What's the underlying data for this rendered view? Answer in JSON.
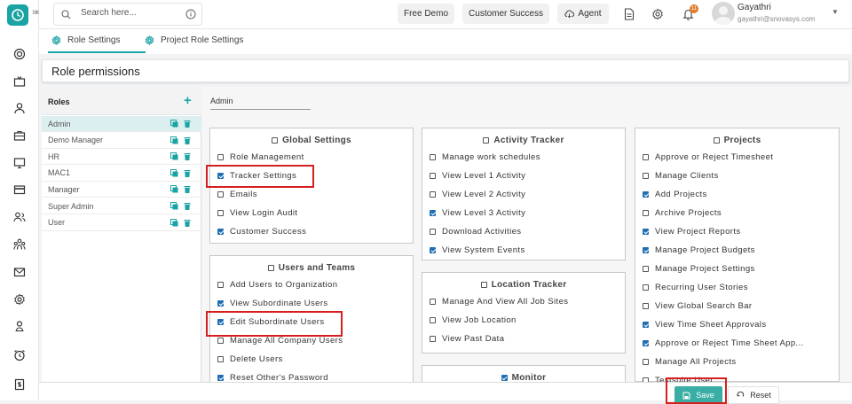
{
  "search": {
    "placeholder": "Search here..."
  },
  "topbar": {
    "free_demo": "Free Demo",
    "customer_success": "Customer Success",
    "agent": "Agent",
    "notification_count": "11",
    "user_name": "Gayathri",
    "user_email": "gayathri@snovasys.com"
  },
  "tabs": [
    {
      "label": "Role Settings"
    },
    {
      "label": "Project Role Settings"
    }
  ],
  "page_title": "Role permissions",
  "roles": {
    "header": "Roles",
    "items": [
      {
        "name": "Admin"
      },
      {
        "name": "Demo Manager"
      },
      {
        "name": "HR"
      },
      {
        "name": "MAC1"
      },
      {
        "name": "Manager"
      },
      {
        "name": "Super Admin"
      },
      {
        "name": "User"
      }
    ]
  },
  "selected_role": "Admin",
  "panels": {
    "global_settings": {
      "title": "Global Settings",
      "items": [
        {
          "label": "Role Management",
          "checked": false
        },
        {
          "label": "Tracker Settings",
          "checked": true
        },
        {
          "label": "Emails",
          "checked": false
        },
        {
          "label": "View Login Audit",
          "checked": false
        },
        {
          "label": "Customer Success",
          "checked": true
        }
      ]
    },
    "users_and_teams": {
      "title": "Users and Teams",
      "items": [
        {
          "label": "Add Users to Organization",
          "checked": false
        },
        {
          "label": "View Subordinate Users",
          "checked": true
        },
        {
          "label": "Edit Subordinate Users",
          "checked": true
        },
        {
          "label": "Manage All Company Users",
          "checked": false
        },
        {
          "label": "Delete Users",
          "checked": false
        },
        {
          "label": "Reset Other's Password",
          "checked": true
        }
      ]
    },
    "activity_tracker": {
      "title": "Activity Tracker",
      "items": [
        {
          "label": "Manage work schedules",
          "checked": false
        },
        {
          "label": "View Level 1 Activity",
          "checked": false
        },
        {
          "label": "View Level 2 Activity",
          "checked": false
        },
        {
          "label": "View Level 3 Activity",
          "checked": true
        },
        {
          "label": "Download Activities",
          "checked": false
        },
        {
          "label": "View System Events",
          "checked": true
        }
      ]
    },
    "location_tracker": {
      "title": "Location Tracker",
      "items": [
        {
          "label": "Manage And View All Job Sites",
          "checked": false
        },
        {
          "label": "View Job Location",
          "checked": false
        },
        {
          "label": "View Past Data",
          "checked": false
        }
      ]
    },
    "monitor": {
      "title": "Monitor",
      "checked": true
    },
    "projects": {
      "title": "Projects",
      "items": [
        {
          "label": "Approve or Reject Timesheet",
          "checked": false
        },
        {
          "label": "Manage Clients",
          "checked": false
        },
        {
          "label": "Add Projects",
          "checked": true
        },
        {
          "label": "Archive Projects",
          "checked": false
        },
        {
          "label": "View Project Reports",
          "checked": true
        },
        {
          "label": "Manage Project Budgets",
          "checked": true
        },
        {
          "label": "Manage Project Settings",
          "checked": false
        },
        {
          "label": "Recurring User Stories",
          "checked": false
        },
        {
          "label": "View Global Search Bar",
          "checked": false
        },
        {
          "label": "View Time Sheet Approvals",
          "checked": true
        },
        {
          "label": "Approve or Reject Time Sheet App...",
          "checked": true
        },
        {
          "label": "Manage All Projects",
          "checked": false
        },
        {
          "label": "Testsuite User",
          "checked": false
        }
      ]
    }
  },
  "actions": {
    "save": "Save",
    "reset": "Reset"
  },
  "colors": {
    "accent": "#1aa3a3",
    "checkbox": "#1f6fb2",
    "highlight": "#d62020",
    "save": "#3aaea4"
  }
}
